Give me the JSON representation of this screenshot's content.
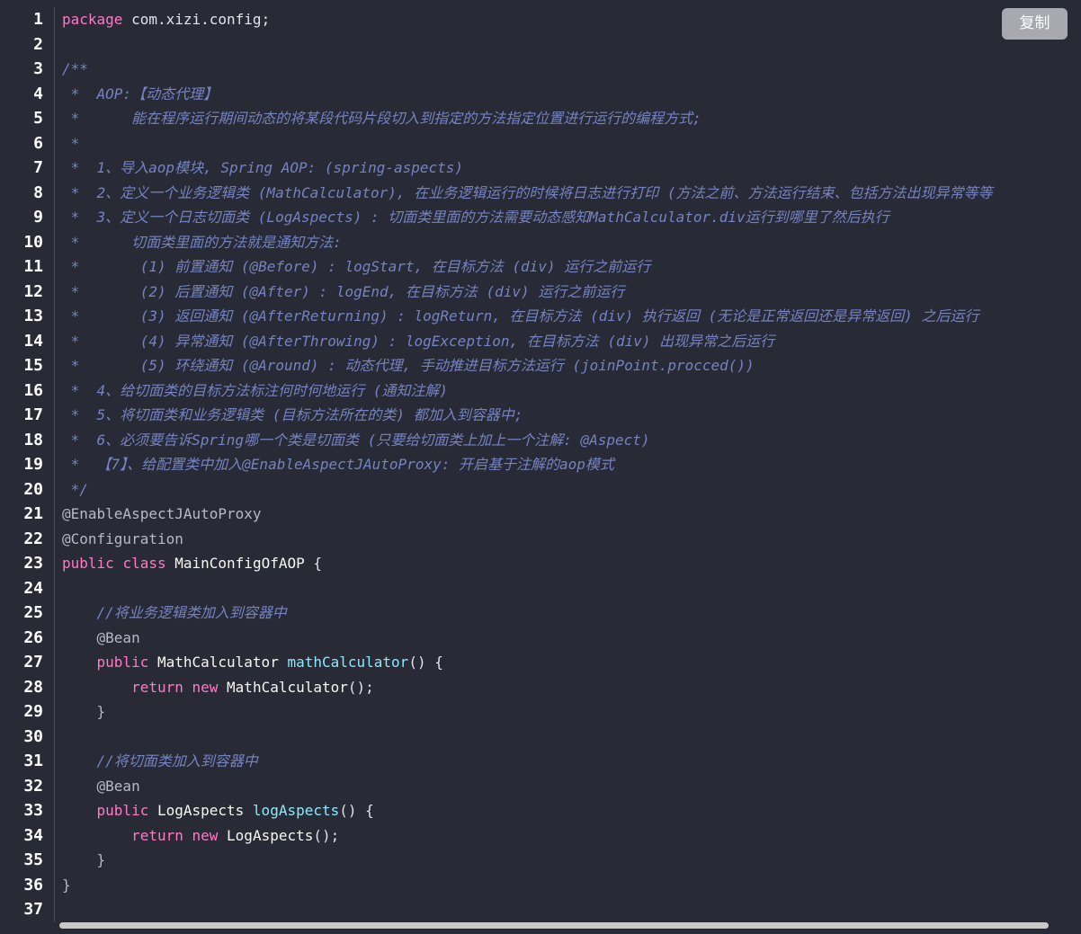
{
  "toolbar": {
    "copy_label": "复制"
  },
  "line_numbers": [
    "1",
    "2",
    "3",
    "4",
    "5",
    "6",
    "7",
    "8",
    "9",
    "10",
    "11",
    "12",
    "13",
    "14",
    "15",
    "16",
    "17",
    "18",
    "19",
    "20",
    "21",
    "22",
    "23",
    "24",
    "25",
    "26",
    "27",
    "28",
    "29",
    "30",
    "31",
    "32",
    "33",
    "34",
    "35",
    "36",
    "37"
  ],
  "code": {
    "l1": [
      "package",
      " com.xizi.config;"
    ],
    "l3": "/**",
    "l4": " *  AOP:【动态代理】",
    "l5": " *      能在程序运行期间动态的将某段代码片段切入到指定的方法指定位置进行运行的编程方式;",
    "l6": " *",
    "l7": " *  1、导入aop模块, Spring AOP: (spring-aspects)",
    "l8": " *  2、定义一个业务逻辑类 (MathCalculator), 在业务逻辑运行的时候将日志进行打印 (方法之前、方法运行结束、包括方法出现异常等等",
    "l9": " *  3、定义一个日志切面类 (LogAspects) : 切面类里面的方法需要动态感知MathCalculator.div运行到哪里了然后执行",
    "l10": " *      切面类里面的方法就是通知方法:",
    "l11": " *       (1) 前置通知 (@Before) : logStart, 在目标方法 (div) 运行之前运行",
    "l12": " *       (2) 后置通知 (@After) : logEnd, 在目标方法 (div) 运行之前运行",
    "l13": " *       (3) 返回通知 (@AfterReturning) : logReturn, 在目标方法 (div) 执行返回 (无论是正常返回还是异常返回) 之后运行",
    "l14": " *       (4) 异常通知 (@AfterThrowing) : logException, 在目标方法 (div) 出现异常之后运行",
    "l15": " *       (5) 环绕通知 (@Around) : 动态代理, 手动推进目标方法运行 (joinPoint.procced())",
    "l16": " *  4、给切面类的目标方法标注何时何地运行 (通知注解)",
    "l17": " *  5、将切面类和业务逻辑类 (目标方法所在的类) 都加入到容器中;",
    "l18": " *  6、必须要告诉Spring哪一个类是切面类 (只要给切面类上加上一个注解: @Aspect)",
    "l19": " *  【7】、给配置类中加入@EnableAspectJAutoProxy: 开启基于注解的aop模式",
    "l20": " */",
    "l21": "@EnableAspectJAutoProxy",
    "l22": "@Configuration",
    "l23": [
      "public",
      " ",
      "class",
      " MainConfigOfAOP ",
      "{"
    ],
    "l25": "    //将业务逻辑类加入到容器中",
    "l26": "    @Bean",
    "l27": [
      "    ",
      "public",
      " MathCalculator ",
      "mathCalculator",
      "() {"
    ],
    "l28": [
      "        ",
      "return",
      " ",
      "new",
      " MathCalculator",
      "();"
    ],
    "l29": "    }",
    "l31": "    //将切面类加入到容器中",
    "l32": "    @Bean",
    "l33": [
      "    ",
      "public",
      " LogAspects ",
      "logAspects",
      "() {"
    ],
    "l34": [
      "        ",
      "return",
      " ",
      "new",
      " LogAspects",
      "();"
    ],
    "l35": "    }",
    "l36": "}"
  },
  "colors": {
    "background": "#282a36",
    "keyword": "#ff79c6",
    "comment": "#7583c2",
    "function": "#8be9fd",
    "annotation": "#b7b9c4"
  }
}
